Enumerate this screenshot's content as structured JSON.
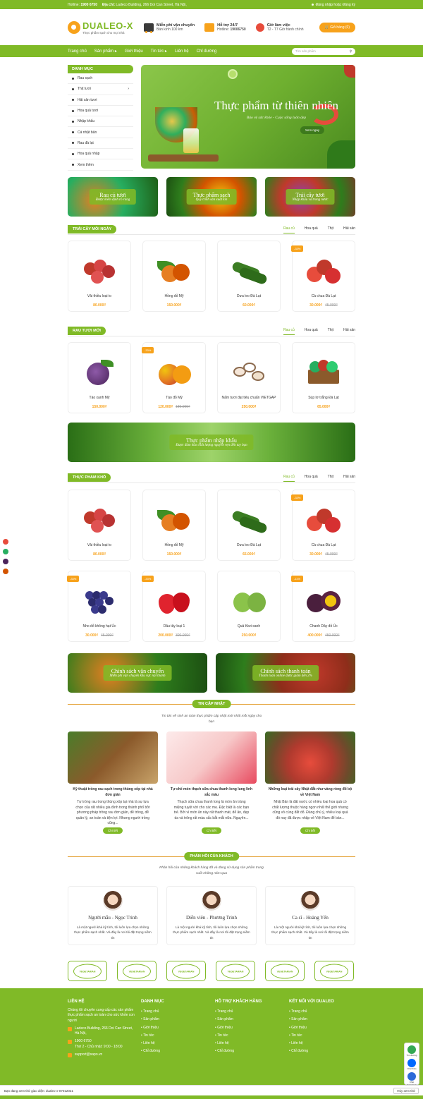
{
  "topbar": {
    "hotline_label": "Hotline:",
    "hotline": "1900 6750",
    "address_label": "Địa chỉ:",
    "address": "Ladeco Building, 266 Doi Can Street, Hà Nội,",
    "login": "Đăng nhập",
    "or": "hoặc",
    "register": "Đăng ký"
  },
  "header": {
    "logo_name": "DUALEO-X",
    "logo_sub": "Thực phẩm sạch cho mọi nhà",
    "shipping_title": "Miễn phí vận chuyển",
    "shipping_sub": "Bán kính 100 km",
    "support_title": "Hỗ trợ 24/7",
    "support_sub_label": "Hotline:",
    "support_sub": "19006750",
    "hours_title": "Giờ làm việc",
    "hours_sub": "T2 - T7 Giờ hành chính",
    "cart": "Giỏ hàng (0)"
  },
  "nav": {
    "items": [
      "Trang chủ",
      "Sản phẩm ▸",
      "Giới thiệu",
      "Tin tức ▸",
      "Liên hệ",
      "Chỉ đường"
    ],
    "search_placeholder": "Tìm sản phẩm",
    "search_icon": "search-icon"
  },
  "sidebar": {
    "title": "DANH MỤC",
    "items": [
      "Rau sạch",
      "Thịt tươi",
      "Hải sản tươi",
      "Hoa quả tươi",
      "Nhập khẩu",
      "Cá nhật bản",
      "Rau đà lạt",
      "Hoa quả nhập",
      "Xem thêm"
    ]
  },
  "hero": {
    "title": "Thực phẩm từ thiên nhiên",
    "subtitle": "Bảo vệ sức khỏe - Cuộc sống luôn đẹp",
    "button": "Xem ngay"
  },
  "promos": [
    {
      "title": "Rau củ tươi",
      "sub": "Được kiểm định rõ ràng"
    },
    {
      "title": "Thực phẩm sạch",
      "sub": "Quy trình sản xuất kín"
    },
    {
      "title": "Trái cây tươi",
      "sub": "Nhập khẩu và trong nước"
    }
  ],
  "tabs": [
    "Rau củ",
    "Hoa quả",
    "Thịt",
    "Hải sản"
  ],
  "section1": {
    "title": "TRÁI CÂY MỖI NGÀY",
    "products": [
      {
        "name": "Vải thiều loại to",
        "price": "80.000₫",
        "old": "",
        "badge": ""
      },
      {
        "name": "Hồng đỏ Mỹ",
        "price": "150.000₫",
        "old": "",
        "badge": ""
      },
      {
        "name": "Dưa leo Đà Lạt",
        "price": "60.000₫",
        "old": "",
        "badge": ""
      },
      {
        "name": "Cà chua Đà Lạt",
        "price": "30.000₫",
        "old": "45.000₫",
        "badge": "-33%"
      }
    ]
  },
  "section2": {
    "title": "RAU TƯƠI MỚI",
    "products": [
      {
        "name": "Táo xanh Mỹ",
        "price": "150.000₫",
        "old": "",
        "badge": ""
      },
      {
        "name": "Táo đỏ Mỹ",
        "price": "120.000₫",
        "old": "180.000₫",
        "badge": "-33%"
      },
      {
        "name": "Nấm tươi đạt tiêu chuẩn VIETGAP",
        "price": "250.000₫",
        "old": "",
        "badge": ""
      },
      {
        "name": "Súp lơ trắng Đà Lạt",
        "price": "65.000₫",
        "old": "",
        "badge": ""
      }
    ]
  },
  "wide_banner": {
    "title": "Thực phẩm nhập khẩu",
    "sub": "Được đảm bảo chất lượng nguyên vẹn đến tay bạn"
  },
  "section3": {
    "title": "THỰC PHẨM KHÔ",
    "products": [
      {
        "name": "Vải thiều loại to",
        "price": "80.000₫",
        "old": "",
        "badge": ""
      },
      {
        "name": "Hồng đỏ Mỹ",
        "price": "150.000₫",
        "old": "",
        "badge": ""
      },
      {
        "name": "Dưa leo Đà Lạt",
        "price": "65.000₫",
        "old": "",
        "badge": ""
      },
      {
        "name": "Cà chua Đà Lạt",
        "price": "30.000₫",
        "old": "45.000₫",
        "badge": "-33%"
      },
      {
        "name": "Nho đỏ không hạt Úc",
        "price": "30.000₫",
        "old": "45.000₫",
        "badge": "-33%"
      },
      {
        "name": "Dâu tây loại 1",
        "price": "200.000₫",
        "old": "300.000₫",
        "badge": "-33%"
      },
      {
        "name": "Quả Kiwi xanh",
        "price": "250.000₫",
        "old": "",
        "badge": ""
      },
      {
        "name": "Chanh Dây đỏ Úc",
        "price": "400.000₫",
        "old": "450.000₫",
        "badge": "-11%"
      }
    ]
  },
  "policies": [
    {
      "title": "Chính sách vận chuyển",
      "sub": "Miễn phí vận chuyển khu vực nội thành"
    },
    {
      "title": "Chính sách thanh toán",
      "sub": "Thanh toán online được giảm đến 2%"
    }
  ],
  "news": {
    "title": "TIN CẬP NHẬT",
    "sub": "Tin tức về sinh an toàn thực phẩm cập nhật mới nhất mỗi ngày cho bạn",
    "items": [
      {
        "title": "Kỹ thuật trồng rau sạch trong thùng xốp tại nhà đơn giản",
        "desc": "Tự trồng rau trong thùng xốp tại nhà là sự lựa chọn của rất nhiều gia đình trong thành phố bởi phương pháp trồng rau đơn giản, dễ trồng, dễ quản lý, an toàn và tiện lợi. Nhưng người trồng cũng...",
        "btn": "Chi tiết"
      },
      {
        "title": "Tự chế món thạch sữa chua thanh long lung linh sắc màu",
        "desc": "Thạch sữa chua thanh long là món ăn tráng miệng tuyệt vời cho các mẹ. Đặc biệt là các bạn trẻ. Bởi vì món ăn này rất thanh mát, dễ ăn, đẹp da và trông rất màu sắc bắt mắt nữa. Nguyên...",
        "btn": "Chi tiết"
      },
      {
        "title": "Những loại trái cây Nhật đắt như vàng ròng đổ bộ về Việt Nam",
        "desc": "Nhật Bản là đất nước có nhiều loại hoa quả có chất lượng thuộc hàng ngon nhất thế giới nhưng cũng vô cùng đắt đỏ. Đáng chú ý, nhiều loại quả đó nay đã được nhập về Việt Nam để bán...",
        "btn": "Chi tiết"
      }
    ]
  },
  "testimonials": {
    "title": "PHẢN HỒI CỦA KHÁCH",
    "sub": "Phản hồi của những khách hàng đã và đang sử dụng sản phẩm trong suốt những năm qua",
    "items": [
      {
        "name": "Người mẫu - Ngọc Trinh",
        "desc": "Là một người khá kỹ tính, tôi luôn lựa chọn những thực phẩm sạch nhất. Và đây là nơi tôi đặt trọng niềm tin"
      },
      {
        "name": "Diễn viên - Phương Trinh",
        "desc": "Là một người khá kỹ tính, tôi luôn lựa chọn những thực phẩm sạch nhất. Và đây là nơi tôi đặt trọng niềm tin"
      },
      {
        "name": "Ca sĩ - Hoàng Yến",
        "desc": "Là một người khá kỹ tính, tôi luôn lựa chọn những thực phẩm sạch nhất. Và đây là nơi tôi đặt trọng niềm tin"
      }
    ]
  },
  "partner_label": "VEGETARIAN",
  "footer": {
    "col1_title": "LIÊN HỆ",
    "col1_text": "Chúng tôi chuyên cung cấp các sản phẩm thực phẩm sạch an toàn cho sức khỏe con người",
    "address": "Ladeco Building, 266 Doi Can Street, Hà Nội,",
    "phone": "1900 6750",
    "hours": "Thứ 2 - Chủ nhật: 9:00 - 18:00",
    "email": "support@sapo.vn",
    "col2_title": "DANH MỤC",
    "col3_title": "HỖ TRỢ KHÁCH HÀNG",
    "col4_title": "KẾT NỐI VỚI DUALEO",
    "links": [
      "Trang chủ",
      "Sản phẩm",
      "Giới thiệu",
      "Tin tức",
      "Liên hệ",
      "Chỉ đường"
    ]
  },
  "bottom_bar": {
    "text": "Bạn đang xem thử giao diện: dualeo-x-07012021",
    "button": "Hủy xem thử"
  },
  "chat": {
    "map": "Tìm đường",
    "zalo": "Chat Zalo",
    "fb": "Chat Facebook"
  }
}
